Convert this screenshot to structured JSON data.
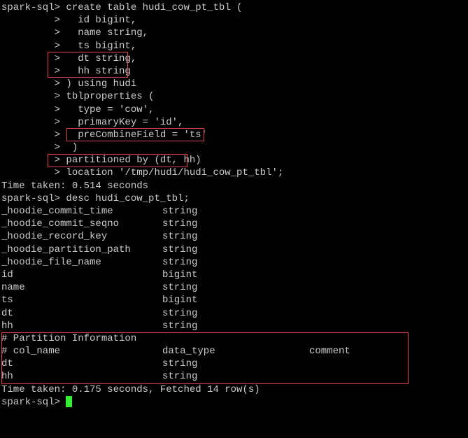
{
  "prompt1": "spark-sql>",
  "cont": "         >",
  "create": {
    "l1": " create table hudi_cow_pt_tbl (",
    "l2": "   id bigint,",
    "l3": "   name string,",
    "l4": "   ts bigint,",
    "l5": "   dt string,",
    "l6": "   hh string",
    "l7": " ) using hudi",
    "l8": " tblproperties (",
    "l9": "   type = 'cow',",
    "l10": "   primaryKey = 'id',",
    "l11_pre": "   ",
    "l11": "preCombineField = 'ts'",
    "l12": "  )",
    "l13": " partitioned by (dt, hh)",
    "l14": " location '/tmp/hudi/hudi_cow_pt_tbl';"
  },
  "time1": "Time taken: 0.514 seconds",
  "desc_cmd": " desc hudi_cow_pt_tbl;",
  "schema": [
    {
      "name": "_hoodie_commit_time",
      "type": "string"
    },
    {
      "name": "_hoodie_commit_seqno",
      "type": "string"
    },
    {
      "name": "_hoodie_record_key",
      "type": "string"
    },
    {
      "name": "_hoodie_partition_path",
      "type": "string"
    },
    {
      "name": "_hoodie_file_name",
      "type": "string"
    },
    {
      "name": "id",
      "type": "bigint"
    },
    {
      "name": "name",
      "type": "string"
    },
    {
      "name": "ts",
      "type": "bigint"
    },
    {
      "name": "dt",
      "type": "string"
    },
    {
      "name": "hh",
      "type": "string"
    }
  ],
  "part_header": "# Partition Information",
  "part_cols_h1": "# col_name",
  "part_cols_h2": "data_type",
  "part_cols_h3": "comment",
  "partitions": [
    {
      "name": "dt",
      "type": "string"
    },
    {
      "name": "hh",
      "type": "string"
    }
  ],
  "time2": "Time taken: 0.175 seconds, Fetched 14 row(s)",
  "final_prompt_pre": "spark-sql> "
}
